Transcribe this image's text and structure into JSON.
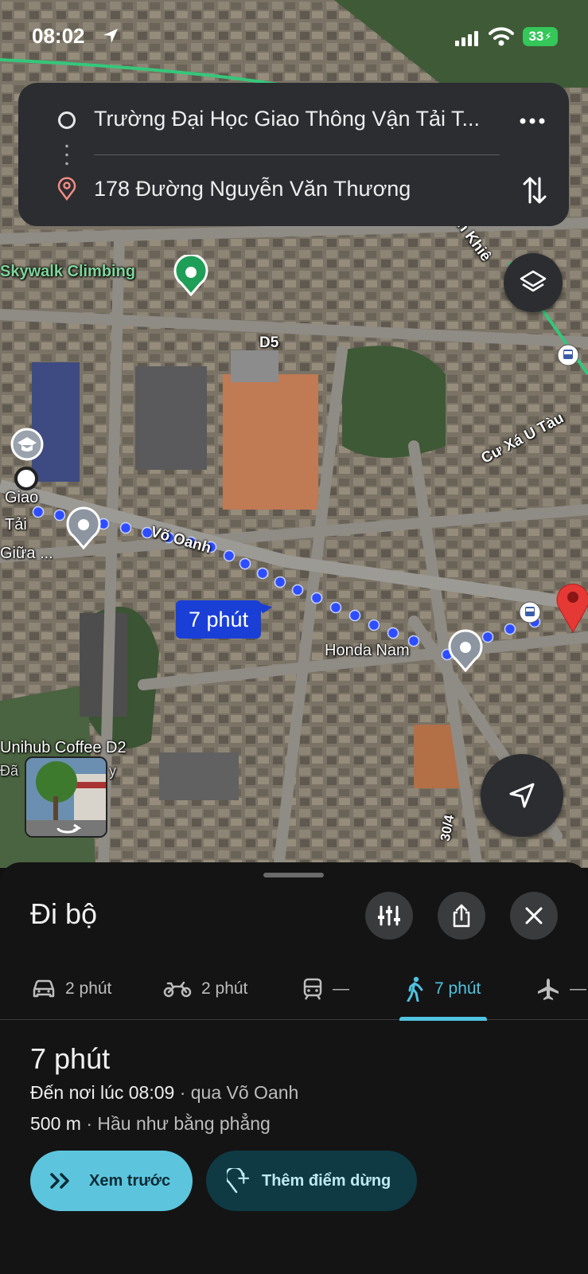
{
  "status_bar": {
    "time": "08:02",
    "battery": "33"
  },
  "route": {
    "origin": "Trường Đại Học Giao Thông Vận Tải T...",
    "destination": "178 Đường Nguyễn Văn Thương"
  },
  "map": {
    "labels": {
      "skywalk": "Skywalk Climbing",
      "d5": "D5",
      "cu_xa": "Cư Xá U Tàu",
      "vo_oanh": "Võ Oanh",
      "honda": "Honda Nam",
      "unihub": "Unihub Coffee D2",
      "unihub_sub": "Đã",
      "unihub_sub2": "y",
      "giao": "Giao",
      "tai": "Tải",
      "giua": "Giữa ...",
      "khiem": "n Khiê",
      "alley": "30/4"
    },
    "time_bubble": "7 phút"
  },
  "sheet": {
    "title": "Đi bộ",
    "modes": [
      {
        "name": "car",
        "label": "2 phút"
      },
      {
        "name": "motorbike",
        "label": "2 phút"
      },
      {
        "name": "transit",
        "label": "—"
      },
      {
        "name": "walk",
        "label": "7 phút",
        "active": true
      },
      {
        "name": "flight",
        "label": "—"
      }
    ],
    "duration": "7 phút",
    "arrival_prefix": "Đến nơi lúc 08:09",
    "arrival_via": " · qua Võ Oanh",
    "distance": "500 m",
    "terrain": " · Hầu như bằng phẳng",
    "preview_label": "Xem trước",
    "add_stop_label": "Thêm điểm dừng"
  },
  "colors": {
    "accent": "#4fc3e1",
    "route_dot": "#2d4dff",
    "pin": "#e53935",
    "place_green": "#1e9e57"
  }
}
